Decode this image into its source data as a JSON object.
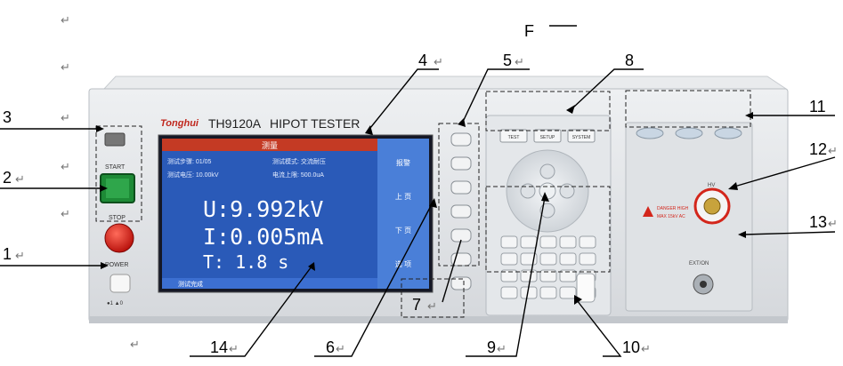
{
  "figure_label": "F",
  "callouts": [
    "1",
    "2",
    "3",
    "4",
    "5",
    "6",
    "7",
    "8",
    "9",
    "10",
    "11",
    "12",
    "13",
    "14"
  ],
  "return_mark": "↵",
  "device": {
    "brand": "Tonghui",
    "model": "TH9120A",
    "name": "HIPOT TESTER",
    "power_label": "POWER",
    "power_state": "●1 ▲0",
    "start_label": "START",
    "stop_label": "STOP",
    "hv_label": "HV",
    "ext_label": "EXT/ON",
    "buttons_top": [
      "TEST",
      "SETUP",
      "SYSTEM"
    ],
    "warning_1": "DANGER HIGH",
    "warning_2": "MAX 15kV AC"
  },
  "screen": {
    "header": "测量",
    "row1_left": "测试步骤: 01/05",
    "row1_right": "测试模式: 交流耐压",
    "row2_left": "测试电压: 10.00kV",
    "row2_right": "电流上限: 500.0uA",
    "voltage": "U:9.992kV",
    "current": "I:0.005mA",
    "time": "T:  1.8  s",
    "status": "测试完成",
    "softkeys": [
      "报警",
      "上 页",
      "下 页",
      "选 项"
    ]
  }
}
